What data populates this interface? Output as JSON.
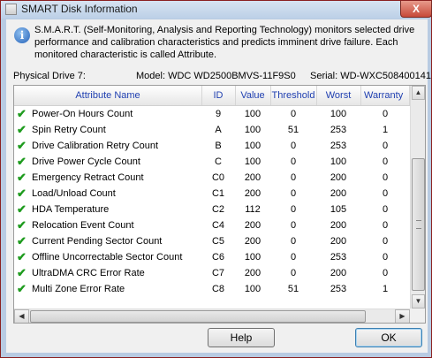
{
  "window": {
    "title": "SMART Disk Information",
    "close_label": "X"
  },
  "info": {
    "icon": "info-icon",
    "text": "S.M.A.R.T. (Self-Monitoring, Analysis and Reporting Technology) monitors selected drive performance and calibration characteristics and predicts imminent drive failure. Each monitored characteristic is called Attribute."
  },
  "drive": {
    "physical_label": "Physical Drive 7:",
    "model_label": "Model: WDC WD2500BMVS-11F9S0",
    "serial_label": "Serial: WD-WXC508400141"
  },
  "table": {
    "columns": [
      "Attribute Name",
      "ID",
      "Value",
      "Threshold",
      "Worst",
      "Warranty"
    ],
    "status_icon": "check-icon",
    "rows": [
      {
        "name": "Power-On Hours Count",
        "id": "9",
        "value": "100",
        "threshold": "0",
        "worst": "100",
        "warranty": "0"
      },
      {
        "name": "Spin Retry Count",
        "id": "A",
        "value": "100",
        "threshold": "51",
        "worst": "253",
        "warranty": "1"
      },
      {
        "name": "Drive Calibration Retry Count",
        "id": "B",
        "value": "100",
        "threshold": "0",
        "worst": "253",
        "warranty": "0"
      },
      {
        "name": "Drive Power Cycle Count",
        "id": "C",
        "value": "100",
        "threshold": "0",
        "worst": "100",
        "warranty": "0"
      },
      {
        "name": "Emergency Retract Count",
        "id": "C0",
        "value": "200",
        "threshold": "0",
        "worst": "200",
        "warranty": "0"
      },
      {
        "name": "Load/Unload Count",
        "id": "C1",
        "value": "200",
        "threshold": "0",
        "worst": "200",
        "warranty": "0"
      },
      {
        "name": "HDA Temperature",
        "id": "C2",
        "value": "112",
        "threshold": "0",
        "worst": "105",
        "warranty": "0"
      },
      {
        "name": "Relocation Event Count",
        "id": "C4",
        "value": "200",
        "threshold": "0",
        "worst": "200",
        "warranty": "0"
      },
      {
        "name": "Current Pending Sector Count",
        "id": "C5",
        "value": "200",
        "threshold": "0",
        "worst": "200",
        "warranty": "0"
      },
      {
        "name": "Offline Uncorrectable Sector Count",
        "id": "C6",
        "value": "100",
        "threshold": "0",
        "worst": "253",
        "warranty": "0"
      },
      {
        "name": "UltraDMA CRC Error Rate",
        "id": "C7",
        "value": "200",
        "threshold": "0",
        "worst": "200",
        "warranty": "0"
      },
      {
        "name": "Multi Zone Error Rate",
        "id": "C8",
        "value": "100",
        "threshold": "51",
        "worst": "253",
        "warranty": "1"
      }
    ]
  },
  "buttons": {
    "help": "Help",
    "ok": "OK"
  },
  "colors": {
    "header_text": "#1f3fb0",
    "check": "#1e9b1e",
    "close": "#c74a3a"
  }
}
